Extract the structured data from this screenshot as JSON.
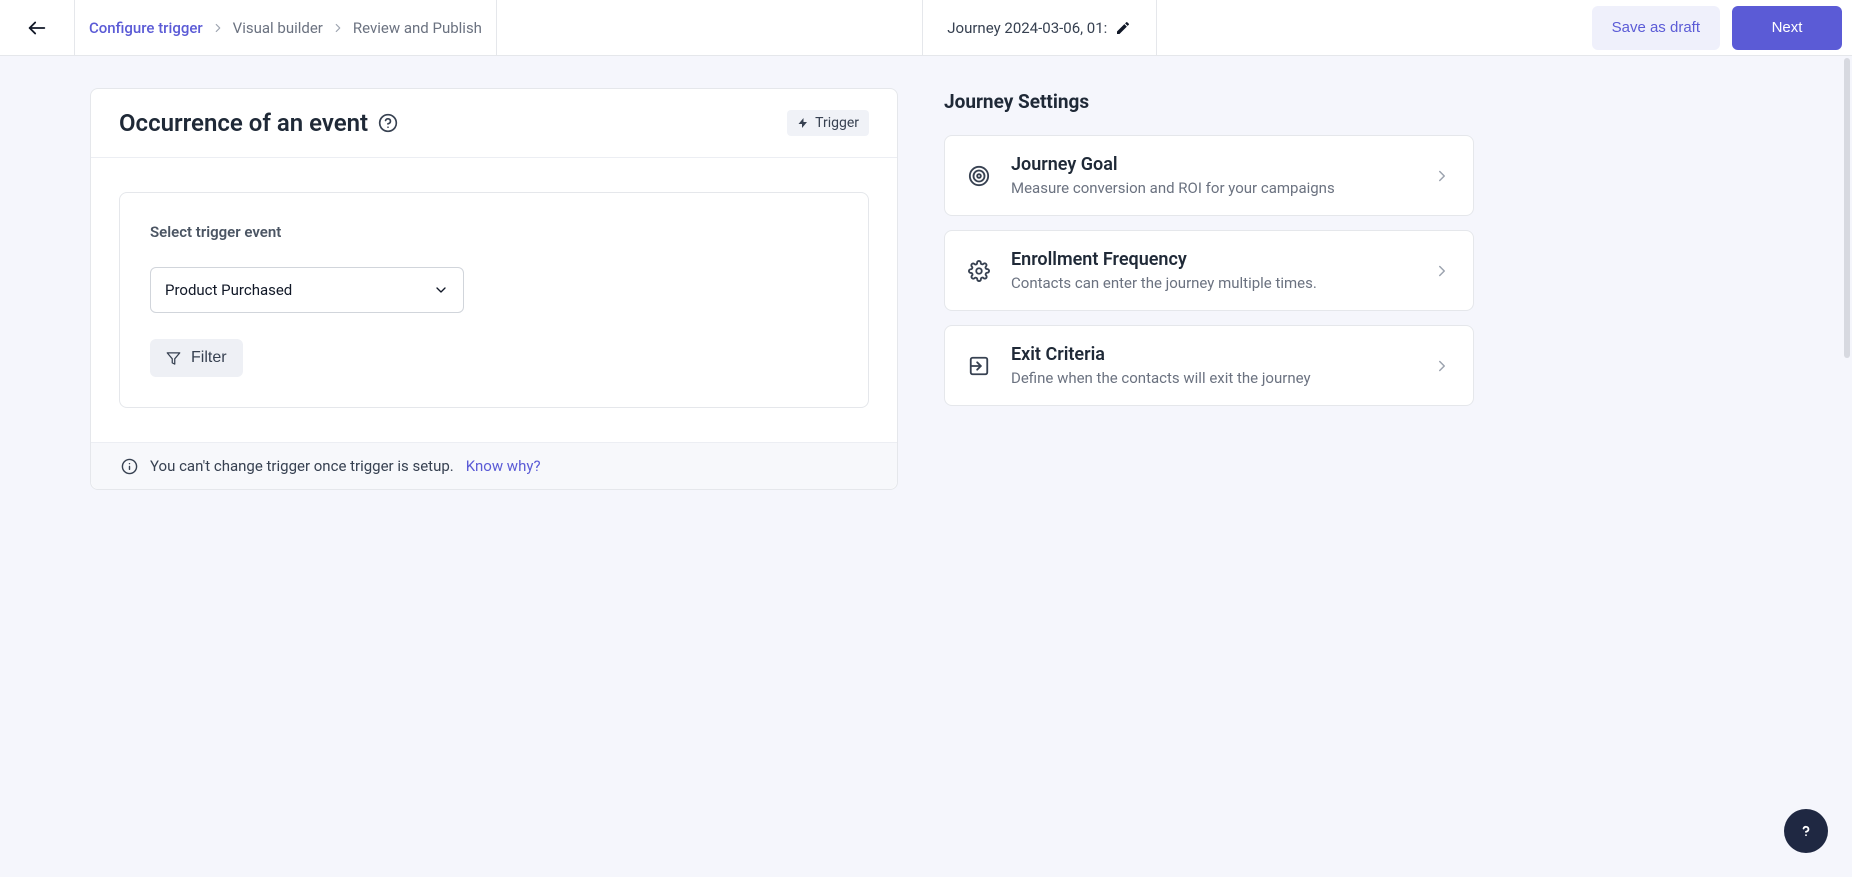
{
  "breadcrumbs": {
    "items": [
      {
        "label": "Configure trigger",
        "active": true
      },
      {
        "label": "Visual builder",
        "active": false
      },
      {
        "label": "Review and Publish",
        "active": false
      }
    ]
  },
  "journey_title": "Journey 2024-03-06, 01:",
  "actions": {
    "save_draft": "Save as draft",
    "next": "Next"
  },
  "trigger_card": {
    "title": "Occurrence of an event",
    "badge": "Trigger",
    "select_label": "Select trigger event",
    "select_value": "Product Purchased",
    "filter_label": "Filter",
    "footer_text": "You can't change trigger once trigger is setup.",
    "know_why": "Know why?"
  },
  "settings": {
    "heading": "Journey Settings",
    "items": [
      {
        "title": "Journey Goal",
        "desc": "Measure conversion and ROI for your campaigns",
        "icon": "target"
      },
      {
        "title": "Enrollment Frequency",
        "desc": "Contacts can enter the journey multiple times.",
        "icon": "gear"
      },
      {
        "title": "Exit Criteria",
        "desc": "Define when the contacts will exit the journey",
        "icon": "exit"
      }
    ]
  }
}
